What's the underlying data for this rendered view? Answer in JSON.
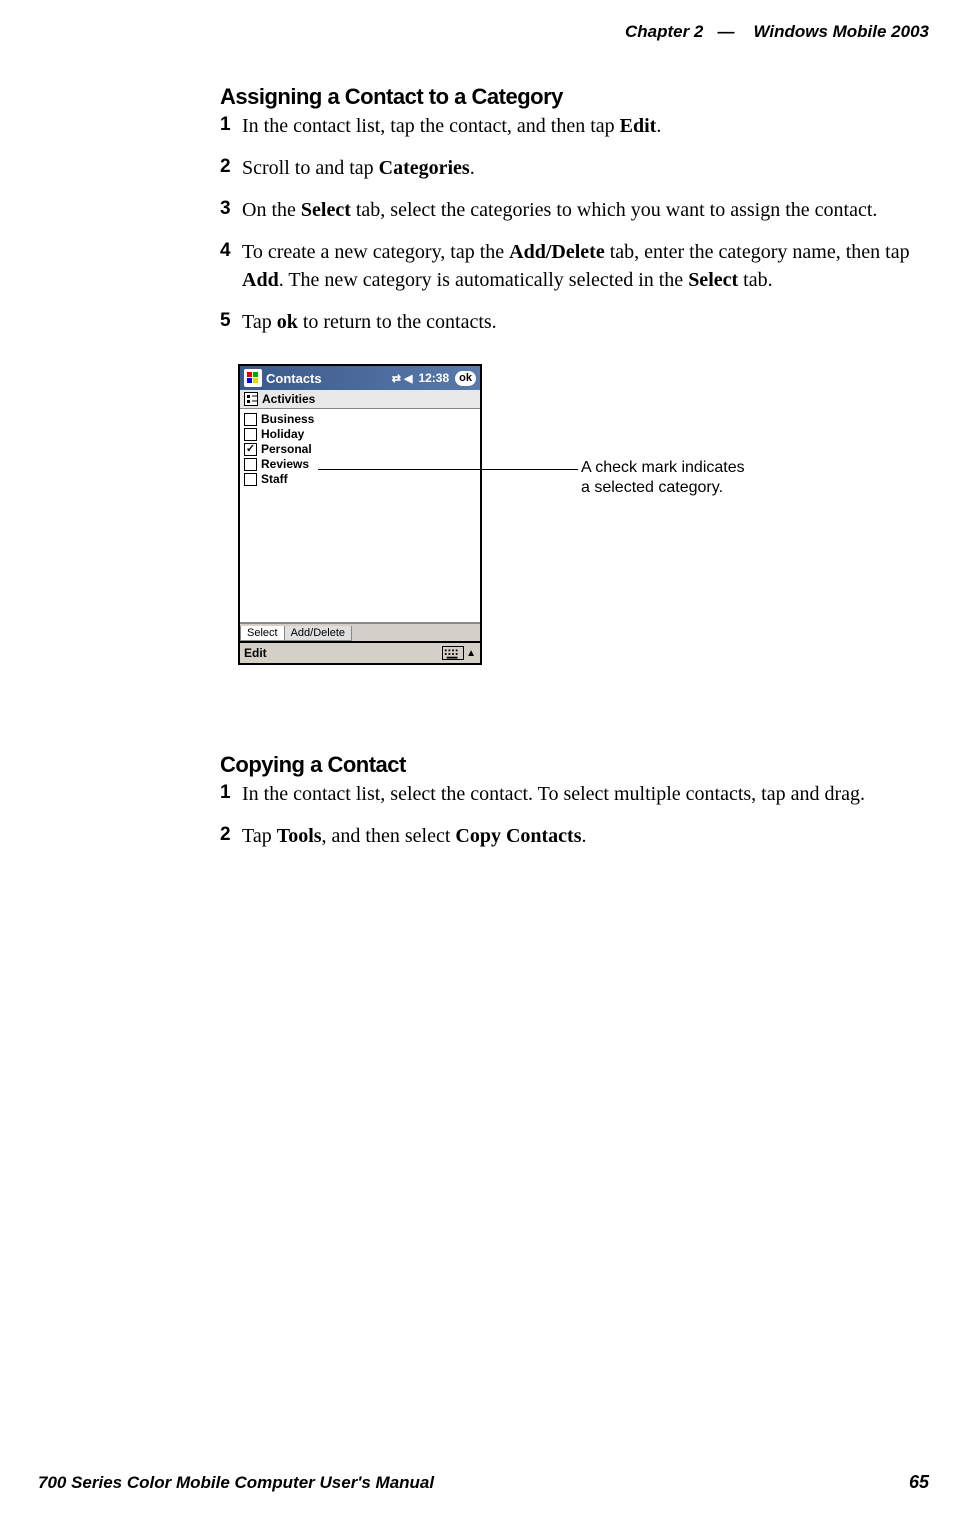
{
  "header": {
    "chapter": "Chapter  2",
    "dash": "—",
    "book_section": "Windows Mobile 2003"
  },
  "section1": {
    "title": "Assigning a Contact to a Category",
    "steps": [
      {
        "num": "1",
        "parts": [
          "In the contact list, tap the contact, and then tap ",
          "Edit",
          "."
        ]
      },
      {
        "num": "2",
        "parts": [
          "Scroll to and tap ",
          "Categories",
          "."
        ]
      },
      {
        "num": "3",
        "parts": [
          "On the ",
          "Select",
          " tab, select the categories to which you want to assign the contact."
        ]
      },
      {
        "num": "4",
        "parts": [
          "To create a new category, tap the ",
          "Add/Delete",
          " tab, enter the category name, then tap ",
          "Add",
          ". The new category is automatically selected in the ",
          "Select",
          " tab."
        ]
      },
      {
        "num": "5",
        "parts": [
          "Tap ",
          "ok",
          " to return to the contacts."
        ]
      }
    ]
  },
  "screenshot": {
    "app_title": "Contacts",
    "time": "12:38",
    "ok_label": "ok",
    "activities_label": "Activities",
    "categories": [
      {
        "label": "Business",
        "checked": false
      },
      {
        "label": "Holiday",
        "checked": false
      },
      {
        "label": "Personal",
        "checked": true
      },
      {
        "label": "Reviews",
        "checked": false
      },
      {
        "label": "Staff",
        "checked": false
      }
    ],
    "tabs": {
      "select": "Select",
      "add_delete": "Add/Delete"
    },
    "edit_label": "Edit"
  },
  "callout": {
    "line1": "A check mark indicates",
    "line2": "a selected category."
  },
  "section2": {
    "title": "Copying a Contact",
    "steps": [
      {
        "num": "1",
        "parts": [
          "In the contact list, select the contact. To select multiple contacts, tap and drag."
        ]
      },
      {
        "num": "2",
        "parts": [
          "Tap ",
          "Tools",
          ", and then select ",
          "Copy Contacts",
          "."
        ]
      }
    ]
  },
  "footer": {
    "manual": "700 Series Color Mobile Computer User's Manual",
    "page": "65"
  }
}
